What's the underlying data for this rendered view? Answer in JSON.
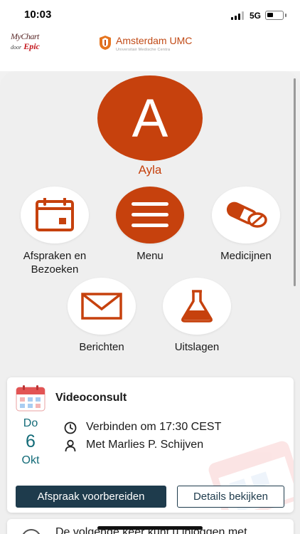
{
  "status_bar": {
    "time": "10:03",
    "network": "5G"
  },
  "header": {
    "mychart_line1": "MyChart",
    "mychart_door": "door",
    "mychart_epic": "Epic",
    "hospital_name": "Amsterdam UMC",
    "hospital_subtitle": "Universitair Medische Centra"
  },
  "profile": {
    "initial": "A",
    "name": "Ayla"
  },
  "tiles": [
    {
      "label": "Afspraken en Bezoeken",
      "icon": "calendar-icon"
    },
    {
      "label": "Menu",
      "icon": "hamburger-menu-icon"
    },
    {
      "label": "Medicijnen",
      "icon": "pill-icon"
    },
    {
      "label": "Berichten",
      "icon": "envelope-icon"
    },
    {
      "label": "Uitslagen",
      "icon": "flask-icon"
    }
  ],
  "appointment_card": {
    "title": "Videoconsult",
    "date_day": "Do",
    "date_number": "6",
    "date_month": "Okt",
    "time_text": "Verbinden om 17:30 CEST",
    "provider_text": "Met Marlies P. Schijven",
    "prepare_button": "Afspraak voorbereiden",
    "details_button": "Details bekijken"
  },
  "next_card": {
    "text": "De volgende keer kunt u inloggen met"
  },
  "colors": {
    "accent": "#c6410d",
    "primary_dark": "#1e3b4c",
    "date_teal": "#136b78",
    "background": "#efefef"
  }
}
